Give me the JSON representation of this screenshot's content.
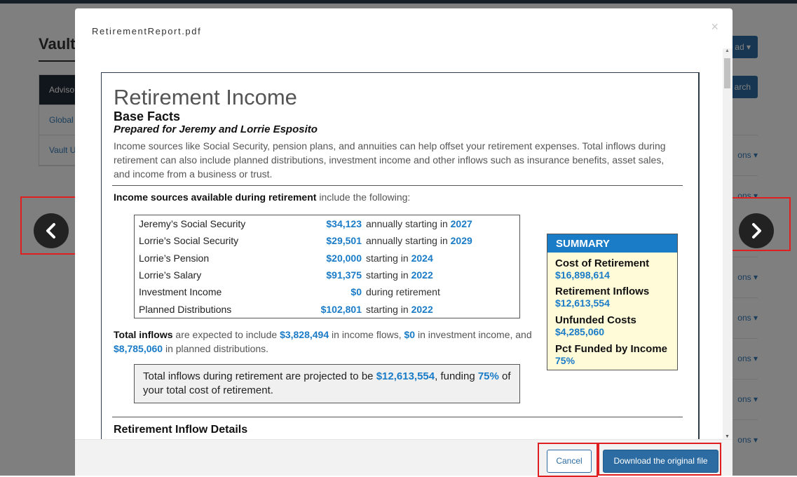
{
  "background": {
    "page_title": "Vault",
    "nav_items": [
      "Adviso",
      "Global",
      "Vault U"
    ],
    "header_button_1": "ad",
    "header_button_2": "arch",
    "row_action_label": "ons"
  },
  "modal": {
    "title": "RetirementReport.pdf",
    "close_glyph": "×",
    "cancel_label": "Cancel",
    "download_label": "Download the original file"
  },
  "report": {
    "title": "Retirement Income",
    "subtitle": "Base Facts",
    "prepared_for": "Prepared for Jeremy and Lorrie Esposito",
    "intro": "Income sources like Social Security, pension plans, and annuities can help offset your retirement expenses. Total inflows during retirement can also include planned distributions, investment income and other inflows such as insurance benefits, asset sales, and income from a business or trust.",
    "sources_heading_bold": "Income sources available during retirement",
    "sources_heading_rest": " include the following:",
    "income_rows": [
      {
        "name": "Jeremy’s Social Security",
        "amount": "$34,123",
        "desc": "annually starting in",
        "year": "2027"
      },
      {
        "name": "Lorrie’s Social Security",
        "amount": "$29,501",
        "desc": "annually starting in",
        "year": "2029"
      },
      {
        "name": "Lorrie’s Pension",
        "amount": "$20,000",
        "desc": "starting in",
        "year": "2024"
      },
      {
        "name": "Lorrie’s Salary",
        "amount": "$91,375",
        "desc": "starting in",
        "year": "2022"
      },
      {
        "name": "Investment Income",
        "amount": "$0",
        "desc": "during retirement",
        "year": ""
      },
      {
        "name": "Planned Distributions",
        "amount": "$102,801",
        "desc": "starting in",
        "year": "2022"
      }
    ],
    "total": {
      "lead": "Total inflows",
      "t1": " are expected to include ",
      "v1": "$3,828,494",
      "t2": " in income flows, ",
      "v2": "$0",
      "t3": " in investment income, and ",
      "v3": "$8,785,060",
      "t4": " in planned distributions."
    },
    "projection": {
      "t1": "Total inflows during retirement are projected to be ",
      "v1": "$12,613,554",
      "t2": ", funding ",
      "v2": "75%",
      "t3": " of your total cost of retirement."
    },
    "summary": {
      "heading": "SUMMARY",
      "items": [
        {
          "label": "Cost of Retirement",
          "value": "$16,898,614"
        },
        {
          "label": "Retirement Inflows",
          "value": "$12,613,554"
        },
        {
          "label": "Unfunded Costs",
          "value": "$4,285,060"
        },
        {
          "label": "Pct Funded by Income",
          "value": "75%"
        }
      ]
    },
    "inflow_details_heading": "Retirement Inflow Details"
  },
  "colors": {
    "accent_blue": "#1a7bc7",
    "button_blue": "#2d6ca2",
    "highlight_red": "#e02020",
    "summary_bg": "#fffbd9"
  },
  "icons": {
    "prev": "chevron-left-icon",
    "next": "chevron-right-icon",
    "close": "close-icon"
  }
}
